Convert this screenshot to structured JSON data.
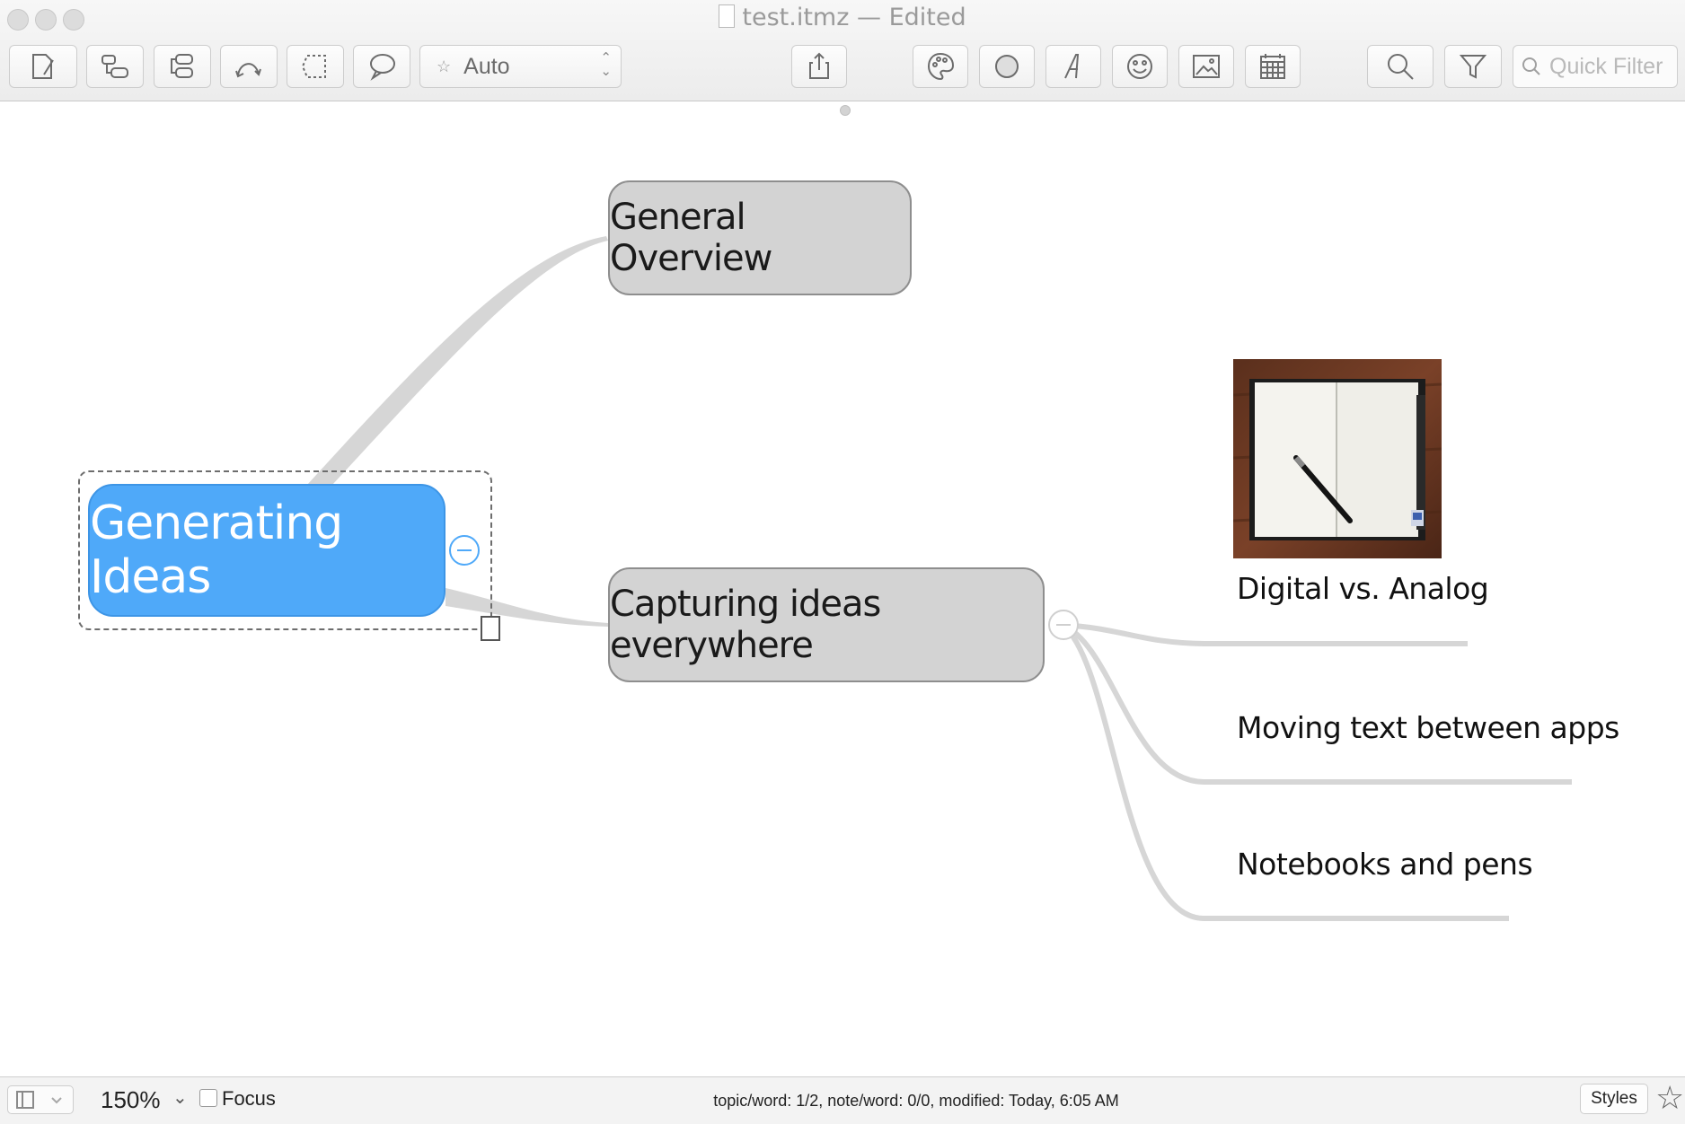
{
  "window": {
    "title": "test.itmz",
    "state": "— Edited"
  },
  "toolbar": {
    "buttons": [
      {
        "icon": "new-topic-icon"
      },
      {
        "icon": "child-topic-icon"
      },
      {
        "icon": "sibling-topic-icon"
      },
      {
        "icon": "relationship-icon"
      },
      {
        "icon": "boundary-icon"
      },
      {
        "icon": "callout-icon"
      },
      {
        "icon": "share-icon"
      },
      {
        "icon": "colors-icon"
      },
      {
        "icon": "shapes-icon"
      },
      {
        "icon": "fonts-icon"
      },
      {
        "icon": "emoji-icon"
      },
      {
        "icon": "image-icon"
      },
      {
        "icon": "calendar-icon"
      },
      {
        "icon": "search-icon"
      },
      {
        "icon": "filter-icon"
      }
    ],
    "layout_select": {
      "value": "Auto"
    },
    "quick_filter": {
      "placeholder": "Quick Filter",
      "value": ""
    }
  },
  "map": {
    "root": {
      "label": "Generating Ideas",
      "color": "#4fa9f9",
      "selected": true
    },
    "main_topics": [
      {
        "label": "General Overview",
        "color": "#d3d3d3"
      },
      {
        "label": "Capturing ideas everywhere",
        "color": "#d3d3d3"
      }
    ],
    "subtopics": [
      {
        "label": "Digital vs. Analog",
        "image": "notebook-and-pen-photo"
      },
      {
        "label": "Moving text between apps"
      },
      {
        "label": "Notebooks and pens"
      }
    ],
    "connector_color": "#d6d6d6"
  },
  "statusbar": {
    "zoom": "150%",
    "focus_label": "Focus",
    "focus_checked": false,
    "info": "topic/word: 1/2, note/word: 0/0, modified: Today, 6:05 AM",
    "styles_label": "Styles"
  }
}
